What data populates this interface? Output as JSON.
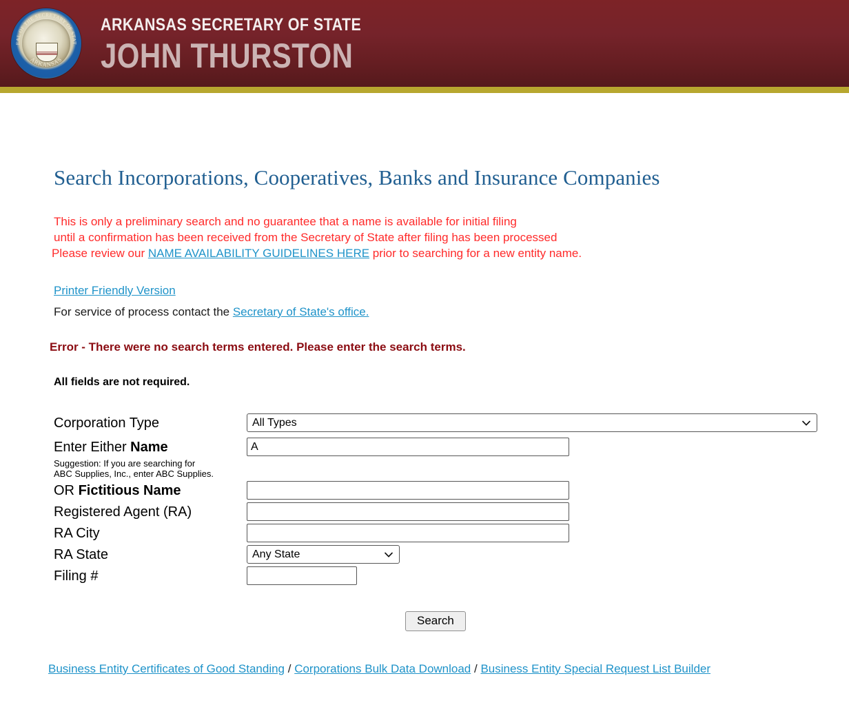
{
  "header": {
    "seal_alt": "seal-of-the-secretary-of-state-arkansas",
    "line1": "ARKANSAS SECRETARY OF STATE",
    "line2": "JOHN THURSTON",
    "bar_color": "#b7a72f",
    "bg_top_color": "#7d2327",
    "bg_bottom_color": "#55191c"
  },
  "main": {
    "title": "Search Incorporations, Cooperatives, Banks and Insurance Companies",
    "title_color": "#215f91",
    "preamble": {
      "color": "#ff2a2a",
      "line1": "This is only a preliminary search and no guarantee that a name is available for initial filing",
      "line2": "until a confirmation has been received from the Secretary of State after filing has been processed",
      "line3_before": "Please review our ",
      "line3_link": "NAME AVAILABILITY GUIDELINES HERE",
      "line3_after": " prior to searching for a new entity name."
    },
    "printer_link": "Printer Friendly Version",
    "service_before": "For service of process contact the ",
    "service_link": "Secretary of State's office.",
    "error_text": "Error - There were no search terms entered. Please enter the search terms.",
    "error_color": "#8b0c12",
    "required_note": "All fields are not required."
  },
  "form": {
    "corporation_type": {
      "label": "Corporation Type",
      "value": "All Types"
    },
    "name": {
      "label_prefix": "Enter Either ",
      "label_bold": "Name",
      "value": "A",
      "suggestion_line1": "Suggestion: If you are searching for",
      "suggestion_line2": "ABC Supplies, Inc., enter ABC Supplies."
    },
    "fictitious_name": {
      "label_prefix": "OR ",
      "label_bold": "Fictitious Name",
      "value": ""
    },
    "registered_agent": {
      "label": "Registered Agent (RA)",
      "value": ""
    },
    "ra_city": {
      "label": "RA City",
      "value": ""
    },
    "ra_state": {
      "label": "RA State",
      "value": "Any State"
    },
    "filing_number": {
      "label": "Filing #",
      "value": ""
    },
    "search_button": "Search"
  },
  "footer": {
    "link1": "Business Entity Certificates of Good Standing",
    "sep1": " / ",
    "link2": "Corporations Bulk Data Download",
    "sep2": " / ",
    "link3": "Business Entity Special Request List Builder"
  }
}
